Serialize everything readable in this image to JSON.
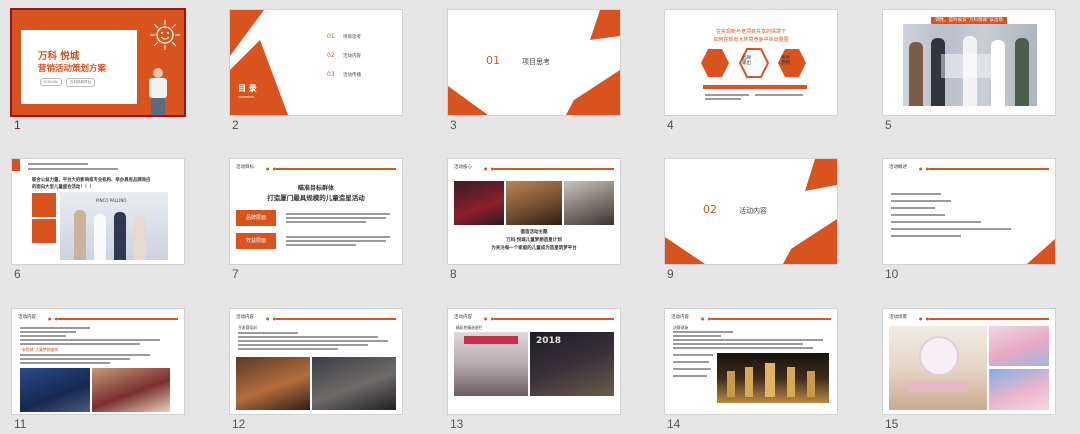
{
  "colors": {
    "accent": "#d9531e",
    "selected": "#a0121b",
    "panel_bg": "#e6e6e6"
  },
  "slides": [
    {
      "number": "1",
      "title_line1": "万科 悦城",
      "title_line2": "营销活动策划方案",
      "tag1": "SHIGAN",
      "tag2": "万科悦城项目"
    },
    {
      "number": "2",
      "toc_title": "目 录",
      "toc_sub": "CONTENTS",
      "items": [
        {
          "n": "01",
          "label": "项目思考"
        },
        {
          "n": "02",
          "label": "活动内容"
        },
        {
          "n": "03",
          "label": "活动传播"
        }
      ]
    },
    {
      "number": "3",
      "section_num": "01",
      "section_title": "项目思考"
    },
    {
      "number": "4",
      "heading1": "在实现新与老项目共享的情境下",
      "heading2": "如何在现有大环境竞争中杀出重围",
      "box1": "品牌\n输出",
      "box2": "事件\n营销"
    },
    {
      "number": "5",
      "banner": "调性，是时候说“万科悦城”该出场"
    },
    {
      "number": "6",
      "slogan1": "联合公益力量，平台大的影响或专业机构、举办具有品牌效应",
      "slogan2": "的面向大型儿童盛会活动！！！",
      "brand": "PINCO PALLINO"
    },
    {
      "number": "7",
      "label": "活动目标",
      "heading1": "瞄准目标群体",
      "heading2": "打造厦门最具规模的儿童造星活动",
      "btn1": "品牌层面",
      "btn2": "效益层面"
    },
    {
      "number": "8",
      "label": "活动核心",
      "line1": "倡造活动主题",
      "line2": "万科 悦城儿童梦想造星计划",
      "line3": "为关注每一个家庭的儿童成为造星筑梦平台"
    },
    {
      "number": "9",
      "section_num": "02",
      "section_title": "活动内容"
    },
    {
      "number": "10",
      "label": "活动概述"
    },
    {
      "number": "11",
      "label": "活动内容",
      "sub": "“安悦城”儿童梦想盛典"
    },
    {
      "number": "12",
      "label": "活动内容",
      "sub": "开发赛培训"
    },
    {
      "number": "13",
      "label": "活动内容",
      "sub": "精彩热情造星栏",
      "photo_text": "2018"
    },
    {
      "number": "14",
      "label": "活动内容",
      "sub": "决赛现场"
    },
    {
      "number": "15",
      "label": "活动场景"
    }
  ]
}
